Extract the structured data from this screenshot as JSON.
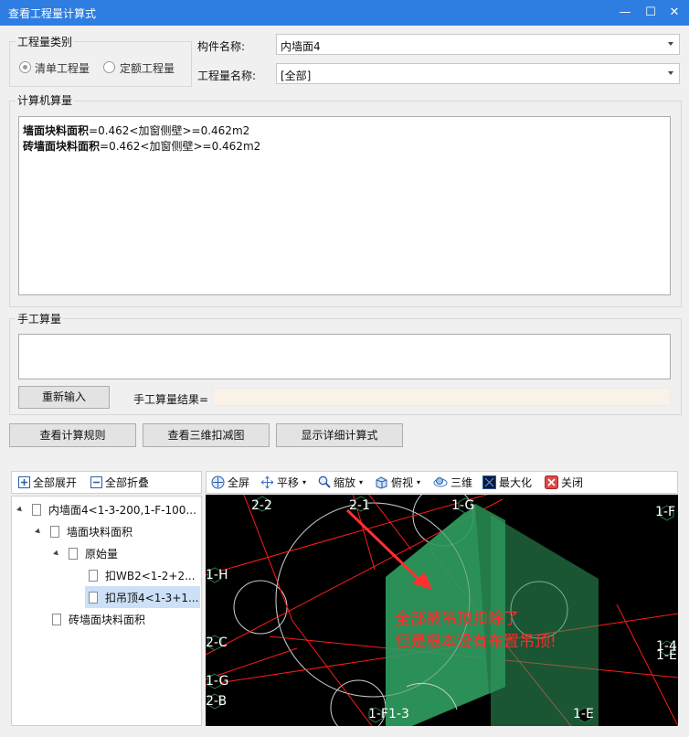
{
  "window": {
    "title": "查看工程量计算式",
    "minimize": "—",
    "maximize": "☐",
    "close": "✕"
  },
  "category": {
    "group_label": "工程量类别",
    "option1": "清单工程量",
    "option2": "定额工程量"
  },
  "component": {
    "label": "构件名称:",
    "value": "内墙面4"
  },
  "quantity": {
    "label": "工程量名称:",
    "value": "[全部]"
  },
  "computer": {
    "group_label": "计算机算量",
    "lines": [
      {
        "name": "墙面块料面积",
        "formula": "=0.462<加窗侧壁>=0.462m2"
      },
      {
        "name": "砖墙面块料面积",
        "formula": "=0.462<加窗侧壁>=0.462m2"
      }
    ]
  },
  "manual": {
    "group_label": "手工算量",
    "reenter_button": "重新输入",
    "result_label": "手工算量结果=",
    "result_value": ""
  },
  "actions": {
    "rules_button": "查看计算规则",
    "view3d_button": "查看三维扣减图",
    "detail_button": "显示详细计算式"
  },
  "tree_toolbar": {
    "expand_all": "全部展开",
    "collapse_all": "全部折叠"
  },
  "tree": [
    {
      "label": "内墙面4<1-3-200,1-F-100...",
      "level": 0
    },
    {
      "label": "墙面块料面积",
      "level": 1
    },
    {
      "label": "原始量",
      "level": 2
    },
    {
      "label": "扣WB2<1-2+2...",
      "level": 3
    },
    {
      "label": "扣吊顶4<1-3+1...",
      "level": 3,
      "selected": true
    },
    {
      "label": "砖墙面块料面积",
      "level": 1
    }
  ],
  "view_toolbar": {
    "fullscreen": "全屏",
    "pan": "平移",
    "zoom": "缩放",
    "top_view": "俯视",
    "three_d": "三维",
    "maximize": "最大化",
    "close": "关闭"
  },
  "viewport": {
    "axis_labels": [
      "2-2",
      "2-1",
      "1-G",
      "1-F",
      "1-H",
      "2-C",
      "1-G",
      "2-B",
      "1-F1-3",
      "1-E",
      "1-4",
      "1-E"
    ],
    "annotation_line1": "全部被吊顶扣除了",
    "annotation_line2": "但是根本没有布置吊顶!",
    "colors": {
      "background": "#000000",
      "grid": "#ff1a1a",
      "wall": "#2f9b5f",
      "annotation": "#ff2a2a"
    }
  }
}
